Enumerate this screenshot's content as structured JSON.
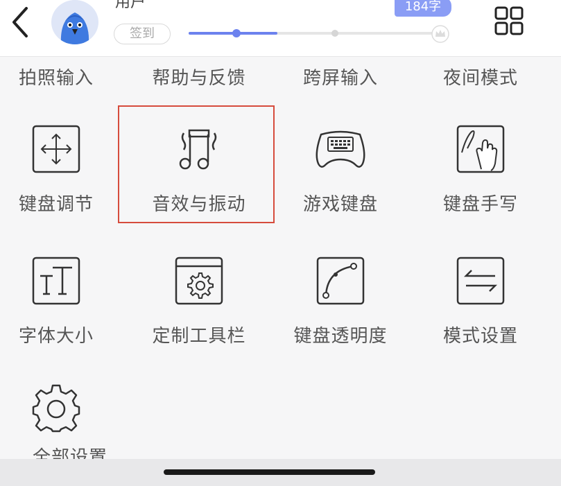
{
  "header": {
    "username": "用户",
    "signin_label": "签到",
    "char_badge": "184字",
    "progress": 0.355
  },
  "top_row": [
    "拍照输入",
    "帮助与反馈",
    "跨屏输入",
    "夜间模式"
  ],
  "row1": [
    {
      "label": "键盘调节",
      "icon": "move-arrows-icon"
    },
    {
      "label": "音效与振动",
      "icon": "music-note-icon"
    },
    {
      "label": "游戏键盘",
      "icon": "gamepad-icon"
    },
    {
      "label": "键盘手写",
      "icon": "handwriting-icon"
    }
  ],
  "row2": [
    {
      "label": "字体大小",
      "icon": "font-size-icon"
    },
    {
      "label": "定制工具栏",
      "icon": "toolbar-gear-icon"
    },
    {
      "label": "键盘透明度",
      "icon": "curve-icon"
    },
    {
      "label": "模式设置",
      "icon": "swap-arrows-icon"
    }
  ],
  "row3": [
    {
      "label": "全部设置",
      "icon": "gear-icon"
    }
  ],
  "colors": {
    "accent": "#6c82ee",
    "highlight": "#d64b3c"
  }
}
